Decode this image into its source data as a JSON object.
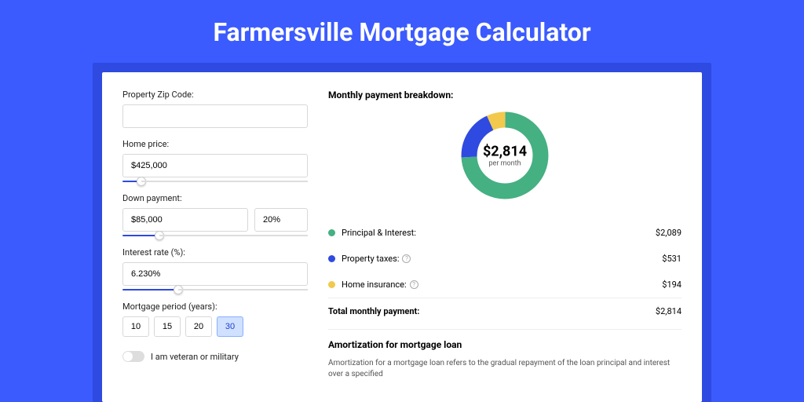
{
  "page_title": "Farmersville Mortgage Calculator",
  "form": {
    "zip_label": "Property Zip Code:",
    "zip_value": "",
    "home_price_label": "Home price:",
    "home_price_value": "$425,000",
    "home_price_slider_pct": 10,
    "down_payment_label": "Down payment:",
    "down_payment_value": "$85,000",
    "down_payment_pct": "20%",
    "down_payment_slider_pct": 20,
    "interest_label": "Interest rate (%):",
    "interest_value": "6.230%",
    "interest_slider_pct": 30,
    "period_label": "Mortgage period (years):",
    "period_options": [
      "10",
      "15",
      "20",
      "30"
    ],
    "period_selected": "30",
    "veteran_label": "I am veteran or military"
  },
  "breakdown": {
    "title": "Monthly payment breakdown:",
    "total_amount": "$2,814",
    "total_sub": "per month",
    "rows": [
      {
        "label": "Principal & Interest:",
        "value": "$2,089",
        "color": "#45b081",
        "help": false
      },
      {
        "label": "Property taxes:",
        "value": "$531",
        "color": "#2f4ae0",
        "help": true
      },
      {
        "label": "Home insurance:",
        "value": "$194",
        "color": "#f2c94c",
        "help": true
      }
    ],
    "total_row": {
      "label": "Total monthly payment:",
      "value": "$2,814"
    }
  },
  "amortization": {
    "title": "Amortization for mortgage loan",
    "text": "Amortization for a mortgage loan refers to the gradual repayment of the loan principal and interest over a specified"
  },
  "chart_data": {
    "type": "pie",
    "title": "Monthly payment breakdown",
    "series": [
      {
        "name": "Principal & Interest",
        "value": 2089,
        "color": "#45b081"
      },
      {
        "name": "Property taxes",
        "value": 531,
        "color": "#2f4ae0"
      },
      {
        "name": "Home insurance",
        "value": 194,
        "color": "#f2c94c"
      }
    ],
    "total": 2814,
    "center_label": "$2,814 per month"
  }
}
